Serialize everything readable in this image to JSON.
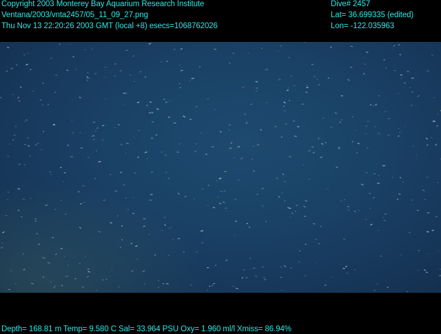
{
  "overlay": {
    "left_lines": [
      "Copyright 2003 Monterey Bay Aquarium Research Institute",
      "Ventana/2003/vnta2457/05_11_09_27.png",
      "Thu Nov 13 22:20:26 2003 GMT (local +8)  esecs=1068762026"
    ],
    "right_lines": [
      "Dive# 2457",
      "Lat= 36.699335 (edited)",
      "Lon= -122.035963"
    ],
    "bottom_line": "Depth= 168.81 m  Temp= 9.580 C  Sal= 33.964 PSU  Oxy= 1.960 ml/l  Xmiss= 86.94%"
  },
  "colors": {
    "overlay_text": "#33e6e6",
    "background": "#000000",
    "water": "#1a4166"
  },
  "scene": {
    "description_icon": "marine-snow-particles"
  }
}
